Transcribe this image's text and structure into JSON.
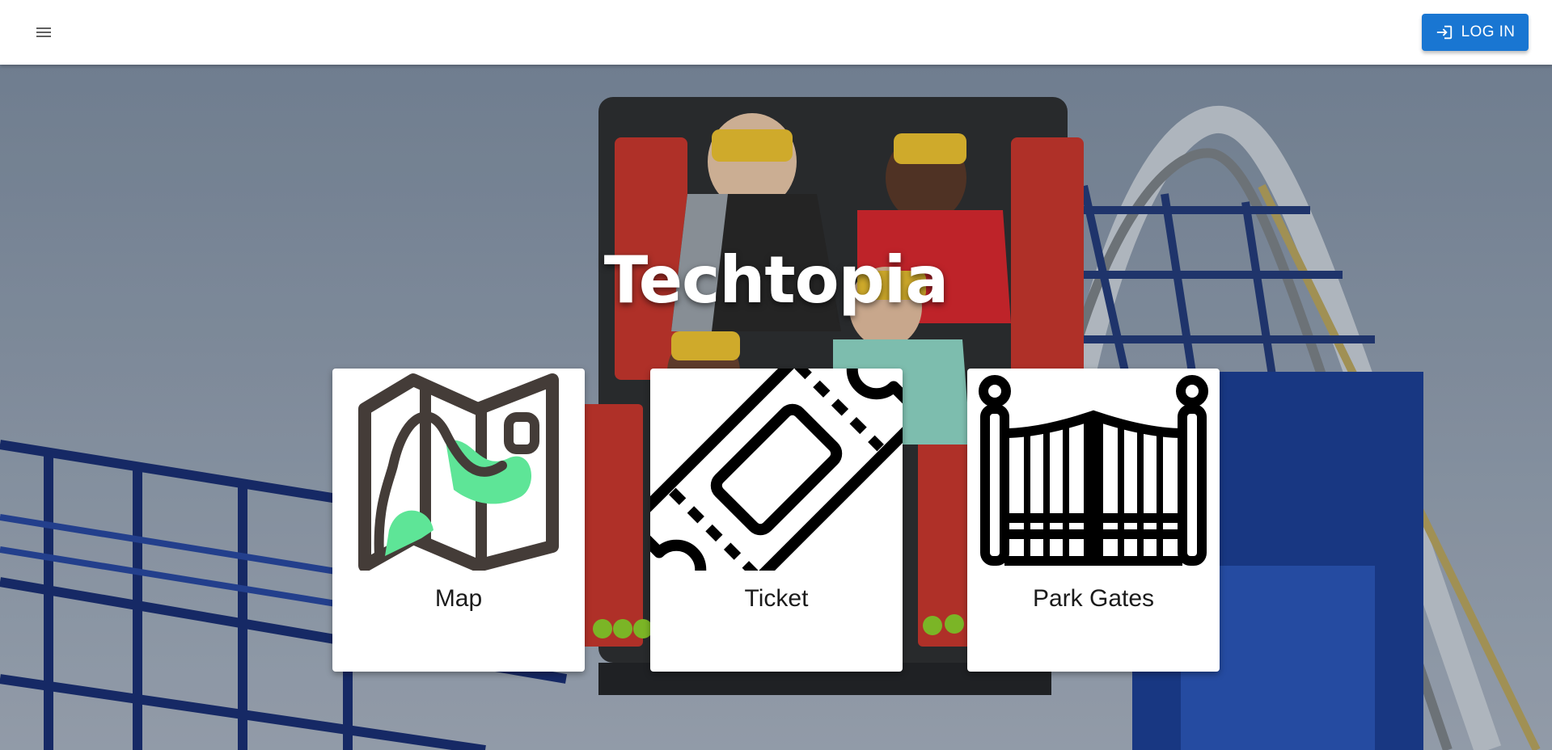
{
  "header": {
    "menu_icon": "hamburger-menu-icon",
    "login_label": "LOG IN",
    "login_icon": "login-icon"
  },
  "hero": {
    "title": "Techtopia",
    "background": "roller-coaster-vr-riders-photo"
  },
  "cards": [
    {
      "label": "Map",
      "icon": "map-icon"
    },
    {
      "label": "Ticket",
      "icon": "ticket-icon"
    },
    {
      "label": "Park Gates",
      "icon": "park-gates-icon"
    }
  ],
  "colors": {
    "primary": "#1976d2",
    "map_dark": "#443c38",
    "map_accent": "#5ee597"
  }
}
